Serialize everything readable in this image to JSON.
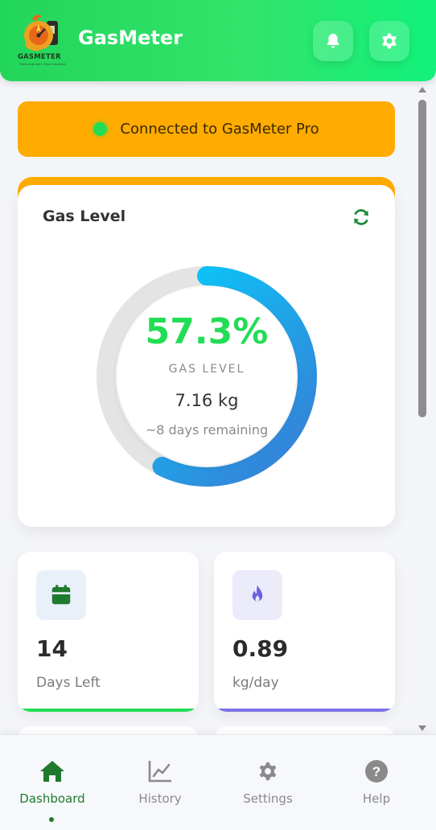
{
  "header": {
    "title": "GasMeter",
    "logo_text": "GASMETER",
    "logo_subtext": "Track and alert. Stay informed.",
    "notifications_icon": "bell-icon",
    "settings_icon": "gear-icon",
    "colors": {
      "start": "#22d65a",
      "end": "#12f27a"
    }
  },
  "connection": {
    "status_text": "Connected to GasMeter Pro",
    "status_color": "#22dd55",
    "banner_color": "#ffab00"
  },
  "gas_level": {
    "title": "Gas Level",
    "refresh_icon": "refresh-icon",
    "percent_text": "57.3%",
    "percent_value": 57.3,
    "label": "GAS LEVEL",
    "weight": "7.16 kg",
    "remaining": "~8 days remaining",
    "colors": {
      "percent": "#22dd55",
      "gauge_start": "#00d4ff",
      "gauge_end": "#3a7bd5",
      "track": "#e4e4e4"
    }
  },
  "stats": [
    {
      "icon": "calendar-icon",
      "value": "14",
      "label": "Days Left",
      "accent": "#22dd55"
    },
    {
      "icon": "flame-icon",
      "value": "0.89",
      "label": "kg/day",
      "accent": "#7a72e6"
    }
  ],
  "nav": {
    "items": [
      {
        "icon": "home-icon",
        "label": "Dashboard",
        "active": true
      },
      {
        "icon": "chart-line-icon",
        "label": "History",
        "active": false
      },
      {
        "icon": "gear-icon",
        "label": "Settings",
        "active": false
      },
      {
        "icon": "help-icon",
        "label": "Help",
        "active": false
      }
    ]
  }
}
